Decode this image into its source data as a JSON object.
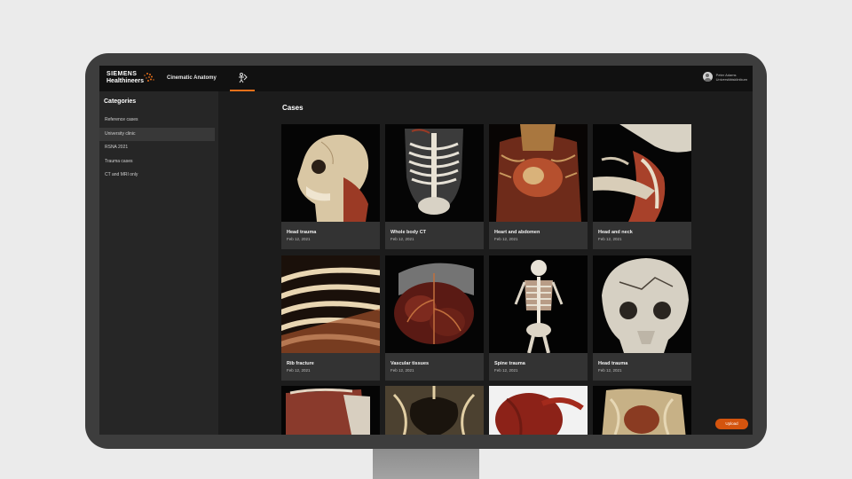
{
  "header": {
    "brand_line1": "SIEMENS",
    "brand_line2": "Healthineers",
    "app_title": "Cinematic Anatomy",
    "nav_icon": "anatomy-figure-icon",
    "user": {
      "name": "Peter Adams",
      "org": "Universitätsklinikum"
    }
  },
  "sidebar": {
    "title": "Categories",
    "items": [
      {
        "label": "Reference cases",
        "active": false
      },
      {
        "label": "University clinic",
        "active": true
      },
      {
        "label": "RSNA 2021",
        "active": false
      },
      {
        "label": "Trauma cases",
        "active": false
      },
      {
        "label": "CT and MRI only",
        "active": false
      }
    ]
  },
  "main": {
    "title": "Cases",
    "cases": [
      {
        "name": "Head trauma",
        "date": "Feb 12, 2021"
      },
      {
        "name": "Whole body CT",
        "date": "Feb 12, 2021"
      },
      {
        "name": "Heart and abdomen",
        "date": "Feb 12, 2021"
      },
      {
        "name": "Head and neck",
        "date": "Feb 12, 2021"
      },
      {
        "name": "Rib fracture",
        "date": "Feb 12, 2021"
      },
      {
        "name": "Vascular tissues",
        "date": "Feb 12, 2021"
      },
      {
        "name": "Spine trauma",
        "date": "Feb 12, 2021"
      },
      {
        "name": "Head trauma",
        "date": "Feb 12, 2021"
      }
    ],
    "upload_label": "Upload"
  },
  "colors": {
    "accent": "#e8701a",
    "upload": "#d4540e",
    "app_bg": "#1c1c1c",
    "sidebar_bg": "#262626",
    "card_bg": "#333333"
  }
}
